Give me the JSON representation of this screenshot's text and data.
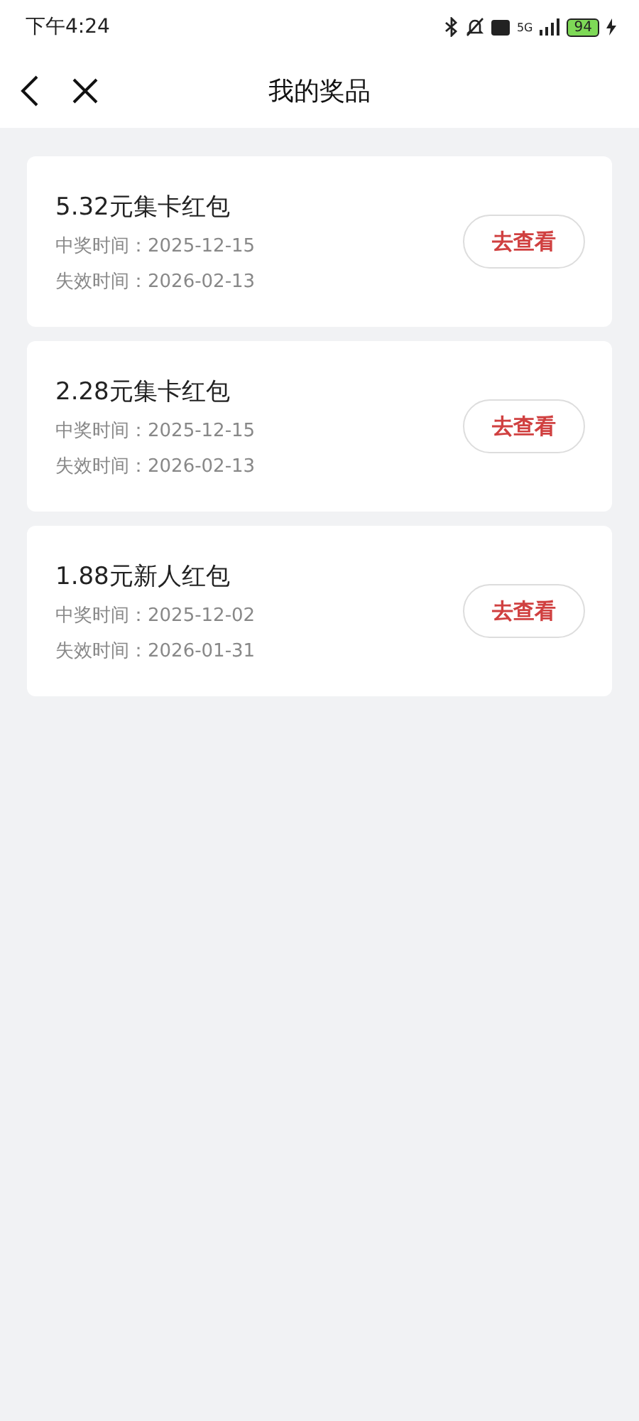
{
  "status_bar": {
    "time": "下午4:24",
    "network": "5G",
    "battery": "94"
  },
  "header": {
    "title": "我的奖品"
  },
  "prizes": [
    {
      "name": "5.32元集卡红包",
      "won_label": "中奖时间：",
      "won_date": "2025-12-15",
      "expire_label": "失效时间：",
      "expire_date": "2026-02-13",
      "button": "去查看"
    },
    {
      "name": "2.28元集卡红包",
      "won_label": "中奖时间：",
      "won_date": "2025-12-15",
      "expire_label": "失效时间：",
      "expire_date": "2026-02-13",
      "button": "去查看"
    },
    {
      "name": "1.88元新人红包",
      "won_label": "中奖时间：",
      "won_date": "2025-12-02",
      "expire_label": "失效时间：",
      "expire_date": "2026-01-31",
      "button": "去查看"
    }
  ]
}
